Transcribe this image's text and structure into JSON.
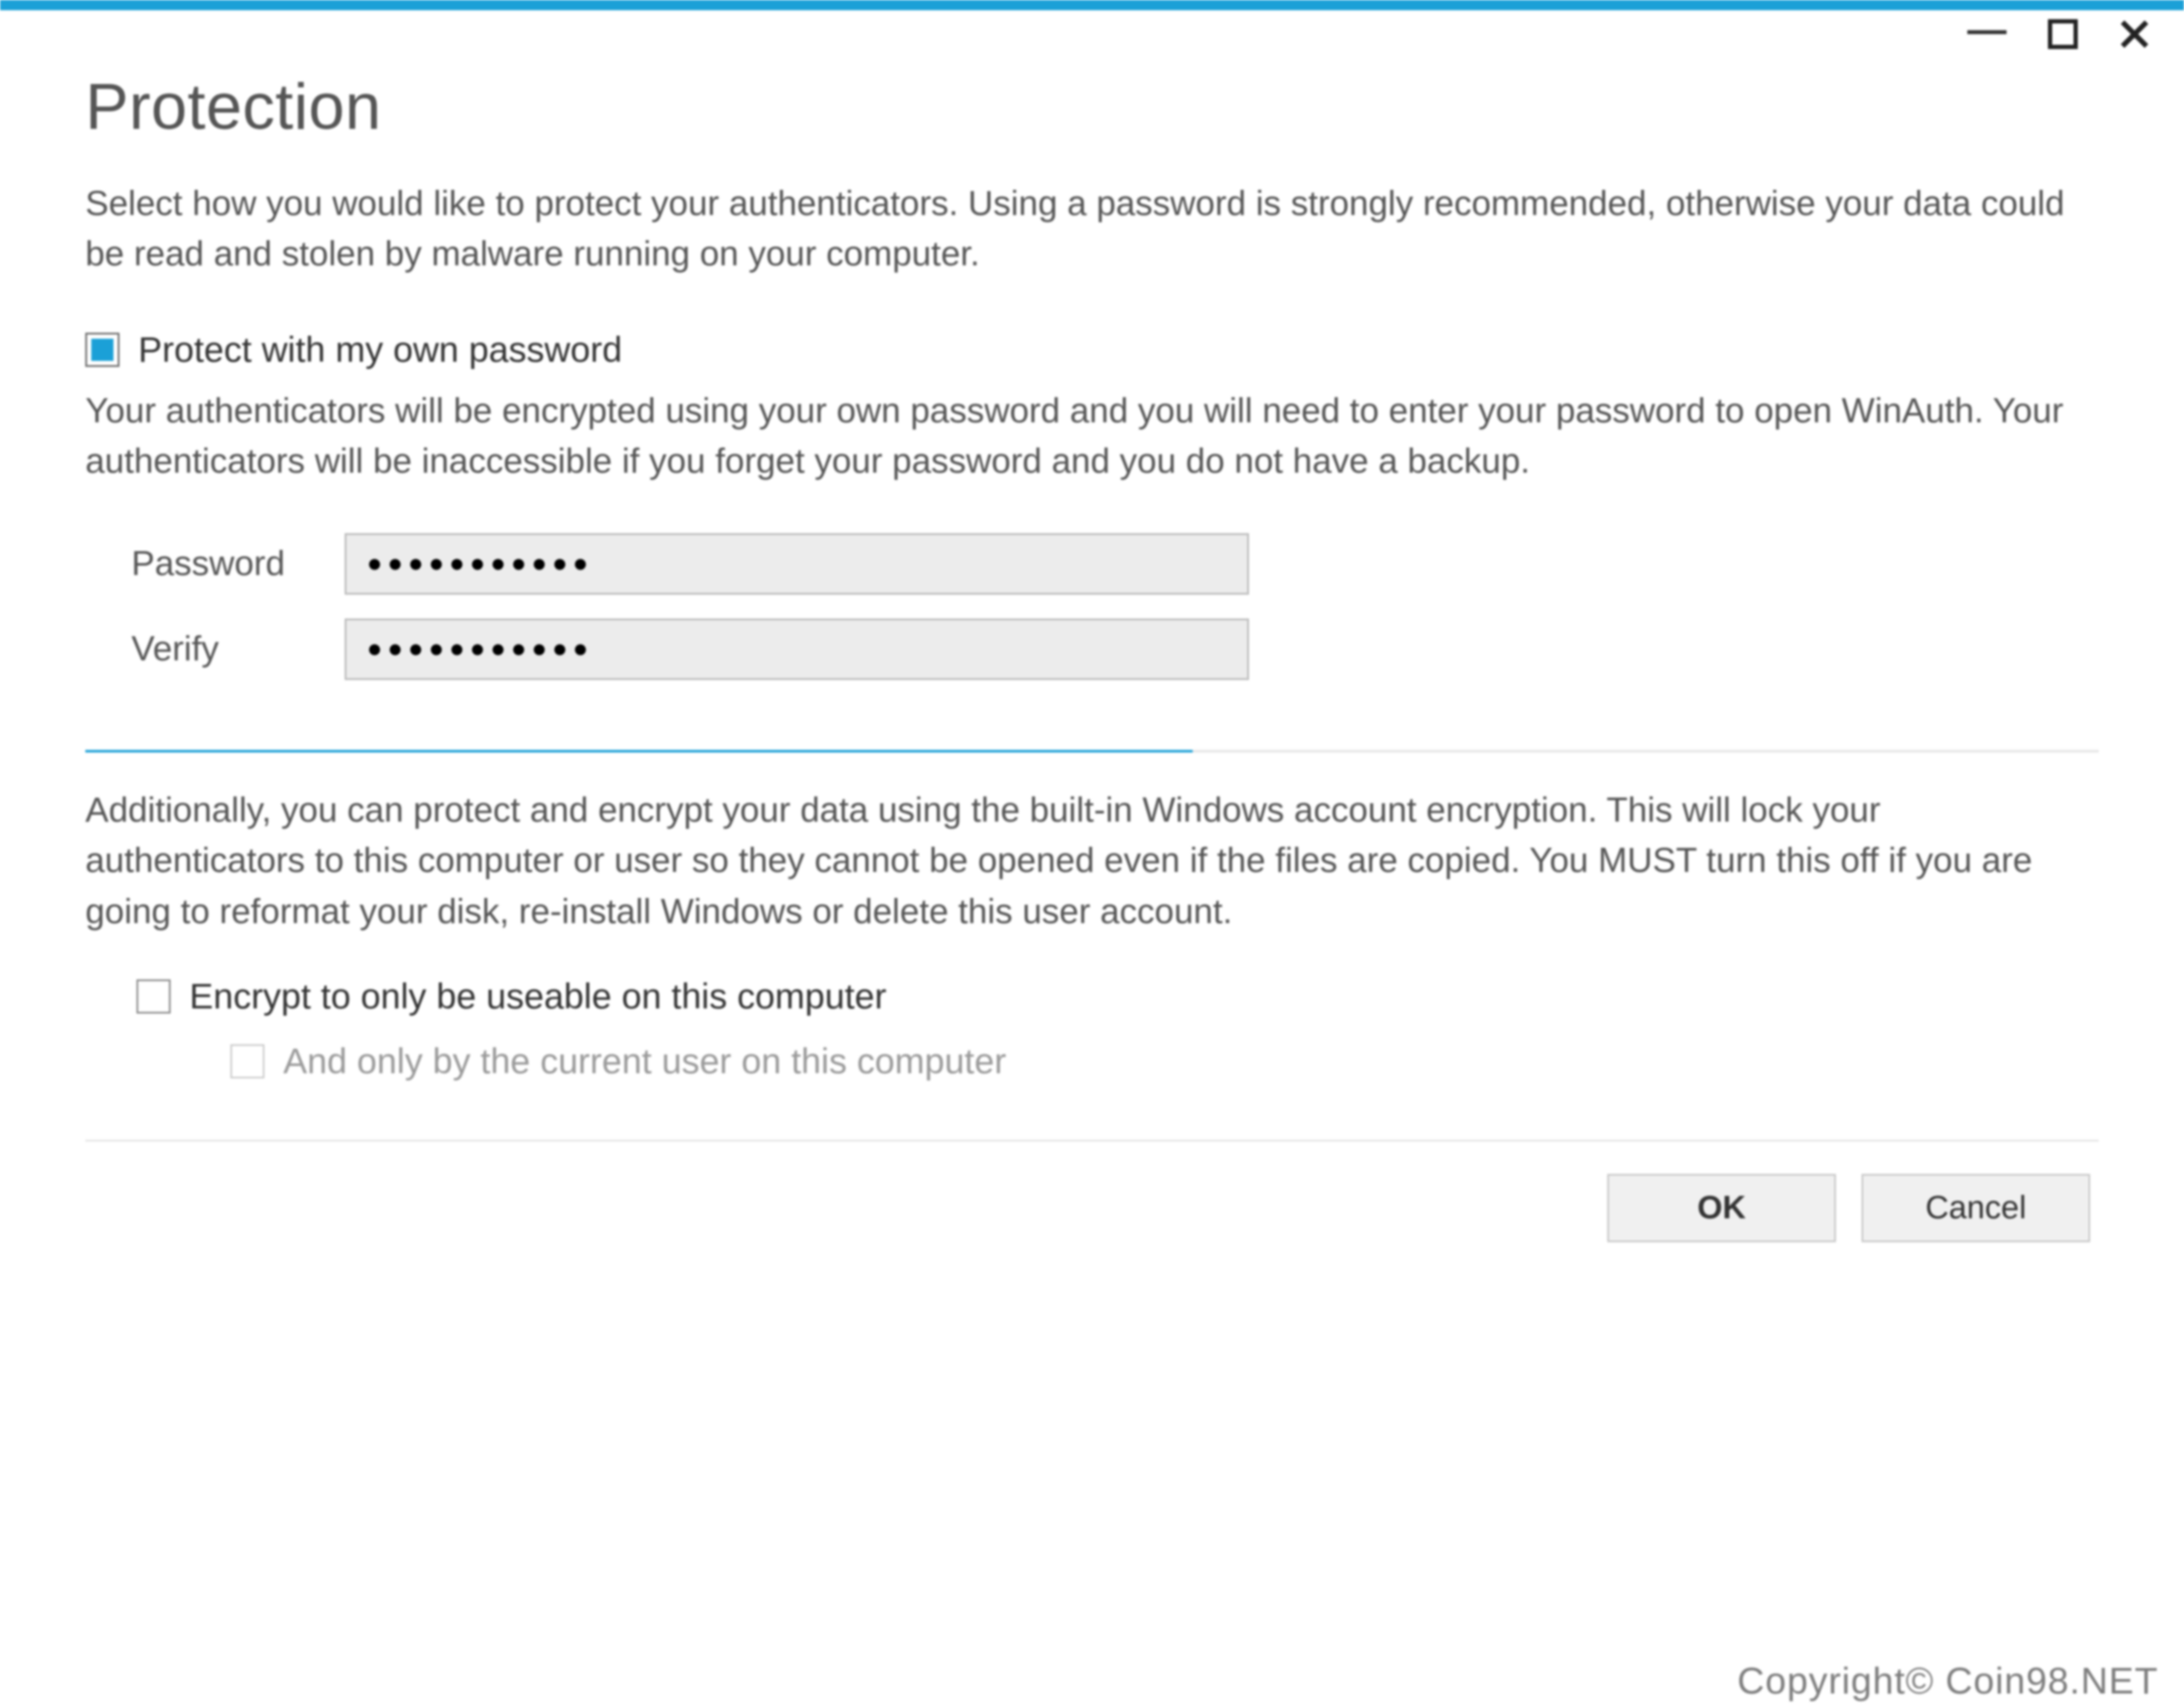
{
  "title": "Protection",
  "intro": "Select how you would like to protect your authenticators. Using a password is strongly recommended, otherwise your data could be read and stolen by malware running on your computer.",
  "passwordOption": {
    "label": "Protect with my own password",
    "description": "Your authenticators will be encrypted using your own password and you will need to enter your password to open WinAuth. Your authenticators will be inaccessible if you forget your password and you do not have a backup.",
    "fields": {
      "passwordLabel": "Password",
      "passwordValue": "●●●●●●●●●●●",
      "verifyLabel": "Verify",
      "verifyValue": "●●●●●●●●●●●"
    }
  },
  "windowsSection": {
    "description": "Additionally, you can protect and encrypt your data using the built-in Windows account encryption. This will lock your authenticators to this computer or user so they cannot be opened even if the files are copied. You MUST turn this off if you are going to reformat your disk, re-install Windows or delete this user account.",
    "computerLabel": "Encrypt to only be useable on this computer",
    "userLabel": "And only by the current user on this computer"
  },
  "buttons": {
    "ok": "OK",
    "cancel": "Cancel"
  },
  "watermark": "Copyright© Coin98.NET"
}
